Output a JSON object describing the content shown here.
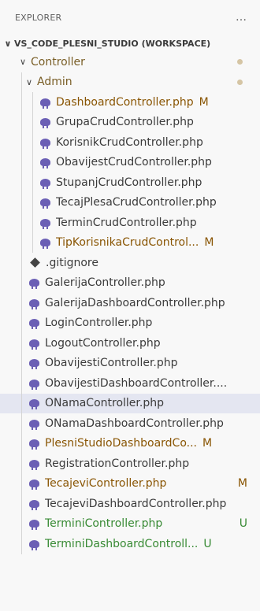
{
  "explorer": {
    "title": "EXPLORER",
    "more_icon": "…"
  },
  "workspace": {
    "name": "VS_CODE_PLESNI_STUDIO (WORKSPACE)"
  },
  "folders": {
    "controller": "Controller",
    "admin": "Admin"
  },
  "admin_files": [
    {
      "name": "DashboardController.php",
      "status": "M"
    },
    {
      "name": "GrupaCrudController.php",
      "status": ""
    },
    {
      "name": "KorisnikCrudController.php",
      "status": ""
    },
    {
      "name": "ObavijestCrudController.php",
      "status": ""
    },
    {
      "name": "StupanjCrudController.php",
      "status": ""
    },
    {
      "name": "TecajPlesaCrudController.php",
      "status": ""
    },
    {
      "name": "TerminCrudController.php",
      "status": ""
    },
    {
      "name": "TipKorisnikaCrudControl...",
      "status": "M"
    }
  ],
  "controller_files": [
    {
      "name": ".gitignore",
      "status": ""
    },
    {
      "name": "GalerijaController.php",
      "status": ""
    },
    {
      "name": "GalerijaDashboardController.php",
      "status": ""
    },
    {
      "name": "LoginController.php",
      "status": ""
    },
    {
      "name": "LogoutController.php",
      "status": ""
    },
    {
      "name": "ObavijestiController.php",
      "status": ""
    },
    {
      "name": "ObavijestiDashboardController....",
      "status": ""
    },
    {
      "name": "ONamaController.php",
      "status": ""
    },
    {
      "name": "ONamaDashboardController.php",
      "status": ""
    },
    {
      "name": "PlesniStudioDashboardCo...",
      "status": "M"
    },
    {
      "name": "RegistrationController.php",
      "status": ""
    },
    {
      "name": "TecajeviController.php",
      "status": "M"
    },
    {
      "name": "TecajeviDashboardController.php",
      "status": ""
    },
    {
      "name": "TerminiController.php",
      "status": "U"
    },
    {
      "name": "TerminiDashboardControll...",
      "status": "U"
    }
  ],
  "colors": {
    "modified": "#895503",
    "untracked": "#388a34",
    "selected_bg": "#e4e6f1",
    "php_icon": "#6b5fb5"
  }
}
